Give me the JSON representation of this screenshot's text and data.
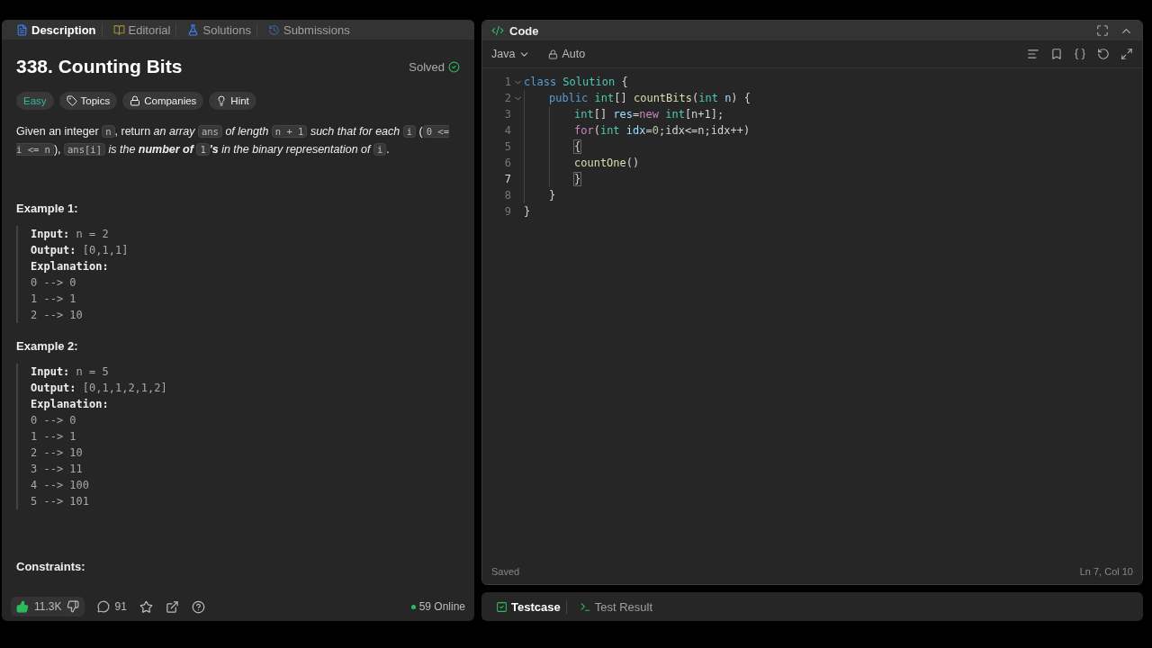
{
  "left_tabs": [
    {
      "label": "Description",
      "selected": true
    },
    {
      "label": "Editorial",
      "selected": false
    },
    {
      "label": "Solutions",
      "selected": false
    },
    {
      "label": "Submissions",
      "selected": false
    }
  ],
  "problem": {
    "title": "338. Counting Bits",
    "status": "Solved",
    "difficulty": "Easy",
    "tags": [
      {
        "label": "Topics"
      },
      {
        "label": "Companies"
      },
      {
        "label": "Hint"
      }
    ],
    "statement": [
      {
        "kind": "text",
        "text": "Given an integer "
      },
      {
        "kind": "code",
        "text": "n"
      },
      {
        "kind": "text",
        "text": ", return "
      },
      {
        "kind": "italic",
        "text": "an array "
      },
      {
        "kind": "code",
        "text": "ans"
      },
      {
        "kind": "italic",
        "text": " of length "
      },
      {
        "kind": "code",
        "text": "n + 1"
      },
      {
        "kind": "italic",
        "text": " such that for each "
      },
      {
        "kind": "code",
        "text": "i"
      },
      {
        "kind": "text",
        "text": " ("
      },
      {
        "kind": "code",
        "text": "0 <= i <= n"
      },
      {
        "kind": "text",
        "text": "), "
      },
      {
        "kind": "code",
        "text": "ans[i]"
      },
      {
        "kind": "italic",
        "text": " is the "
      },
      {
        "kind": "bolditalic",
        "text": "number of "
      },
      {
        "kind": "code",
        "text": "1"
      },
      {
        "kind": "bolditalic",
        "text": "'s"
      },
      {
        "kind": "italic",
        "text": " in the binary representation of "
      },
      {
        "kind": "code",
        "text": "i"
      },
      {
        "kind": "text",
        "text": "."
      }
    ],
    "examples": [
      {
        "title": "Example 1:",
        "lines": [
          {
            "label": "Input:",
            "value": "n = 2"
          },
          {
            "label": "Output:",
            "value": "[0,1,1]"
          },
          {
            "label": "Explanation:"
          },
          {
            "value": "0 --> 0"
          },
          {
            "value": "1 --> 1"
          },
          {
            "value": "2 --> 10"
          }
        ]
      },
      {
        "title": "Example 2:",
        "lines": [
          {
            "label": "Input:",
            "value": "n = 5"
          },
          {
            "label": "Output:",
            "value": "[0,1,1,2,1,2]"
          },
          {
            "label": "Explanation:"
          },
          {
            "value": "0 --> 0"
          },
          {
            "value": "1 --> 1"
          },
          {
            "value": "2 --> 10"
          },
          {
            "value": "3 --> 11"
          },
          {
            "value": "4 --> 100"
          },
          {
            "value": "5 --> 101"
          }
        ]
      }
    ],
    "constraints_title": "Constraints:"
  },
  "footer": {
    "likes": "11.3K",
    "comments": "91",
    "online": "59 Online"
  },
  "editor": {
    "title": "Code",
    "language": "Java",
    "mode": "Auto",
    "lines": [
      {
        "number": "1",
        "foldable": true,
        "current": false,
        "tokens": [
          {
            "kind": "keyword",
            "text": "class "
          },
          {
            "kind": "type",
            "text": "Solution"
          },
          {
            "kind": "plain",
            "text": " {"
          }
        ],
        "children": [
          {
            "number": "2",
            "foldable": true,
            "current": false,
            "tokens": [
              {
                "kind": "keyword",
                "text": "public "
              },
              {
                "kind": "type",
                "text": "int"
              },
              {
                "kind": "plain",
                "text": "[] "
              },
              {
                "kind": "func",
                "text": "countBits"
              },
              {
                "kind": "plain",
                "text": "("
              },
              {
                "kind": "type",
                "text": "int"
              },
              {
                "kind": "var",
                "text": " n"
              },
              {
                "kind": "plain",
                "text": ") {"
              }
            ],
            "children": [
              {
                "number": "3",
                "foldable": false,
                "current": false,
                "tokens": [
                  {
                    "kind": "type",
                    "text": "int"
                  },
                  {
                    "kind": "plain",
                    "text": "[] "
                  },
                  {
                    "kind": "var",
                    "text": "res"
                  },
                  {
                    "kind": "plain",
                    "text": "="
                  },
                  {
                    "kind": "control",
                    "text": "new "
                  },
                  {
                    "kind": "type",
                    "text": "int"
                  },
                  {
                    "kind": "plain",
                    "text": "[n+1];"
                  }
                ]
              },
              {
                "number": "4",
                "foldable": false,
                "current": false,
                "tokens": [
                  {
                    "kind": "control",
                    "text": "for"
                  },
                  {
                    "kind": "plain",
                    "text": "("
                  },
                  {
                    "kind": "type",
                    "text": "int "
                  },
                  {
                    "kind": "var",
                    "text": "idx"
                  },
                  {
                    "kind": "plain",
                    "text": "="
                  },
                  {
                    "kind": "number",
                    "text": "0"
                  },
                  {
                    "kind": "plain",
                    "text": ";idx<=n;idx++)"
                  }
                ]
              },
              {
                "number": "5",
                "foldable": false,
                "current": false,
                "tokens": [
                  {
                    "kind": "bracket",
                    "text": "{"
                  }
                ]
              },
              {
                "number": "6",
                "foldable": false,
                "current": false,
                "tokens": [
                  {
                    "kind": "func",
                    "text": "countOne"
                  },
                  {
                    "kind": "plain",
                    "text": "()"
                  }
                ]
              },
              {
                "number": "7",
                "foldable": false,
                "current": true,
                "tokens": [
                  {
                    "kind": "bracket",
                    "text": "}"
                  }
                ]
              }
            ]
          },
          {
            "number": "8",
            "foldable": false,
            "current": false,
            "tokens": [
              {
                "kind": "plain",
                "text": "}"
              }
            ]
          }
        ]
      },
      {
        "number": "9",
        "foldable": false,
        "current": false,
        "tokens": [
          {
            "kind": "plain",
            "text": "}"
          }
        ]
      }
    ],
    "save_state": "Saved",
    "cursor": "Ln 7, Col 10"
  },
  "bottom_tabs": [
    {
      "label": "Testcase",
      "selected": true
    },
    {
      "label": "Test Result",
      "selected": false
    }
  ]
}
